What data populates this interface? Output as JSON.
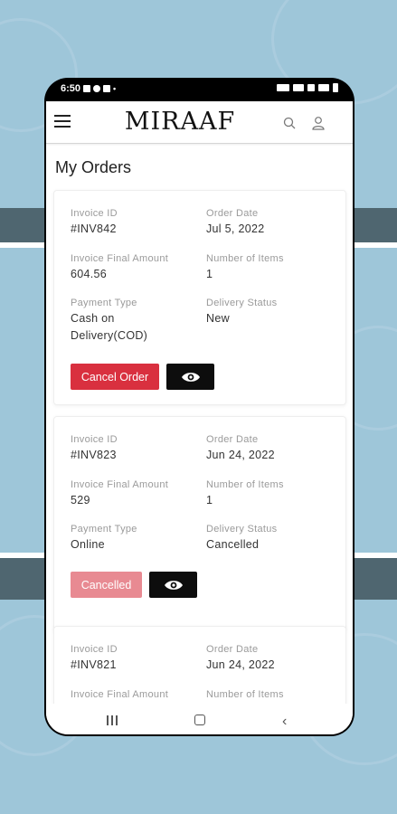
{
  "status_bar": {
    "time": "6:50"
  },
  "app": {
    "logo": "MIRAAF",
    "page_title": "My Orders"
  },
  "labels": {
    "invoice_id": "Invoice ID",
    "order_date": "Order Date",
    "final_amount": "Invoice Final Amount",
    "num_items": "Number of Items",
    "payment_type": "Payment Type",
    "delivery_status": "Delivery Status"
  },
  "orders": [
    {
      "invoice_id": "#INV842",
      "order_date": "Jul 5, 2022",
      "final_amount": "604.56",
      "num_items": "1",
      "payment_type": "Cash on Delivery(COD)",
      "delivery_status": "New",
      "action_label": "Cancel Order"
    },
    {
      "invoice_id": "#INV823",
      "order_date": "Jun 24, 2022",
      "final_amount": "529",
      "num_items": "1",
      "payment_type": "Online",
      "delivery_status": "Cancelled",
      "action_label": "Cancelled"
    },
    {
      "invoice_id": "#INV821",
      "order_date": "Jun 24, 2022"
    }
  ],
  "colors": {
    "cancel_button": "#d9303f",
    "cancelled_button": "#e88a92",
    "view_button": "#0d0d0d",
    "background": "#9ec6d9"
  }
}
